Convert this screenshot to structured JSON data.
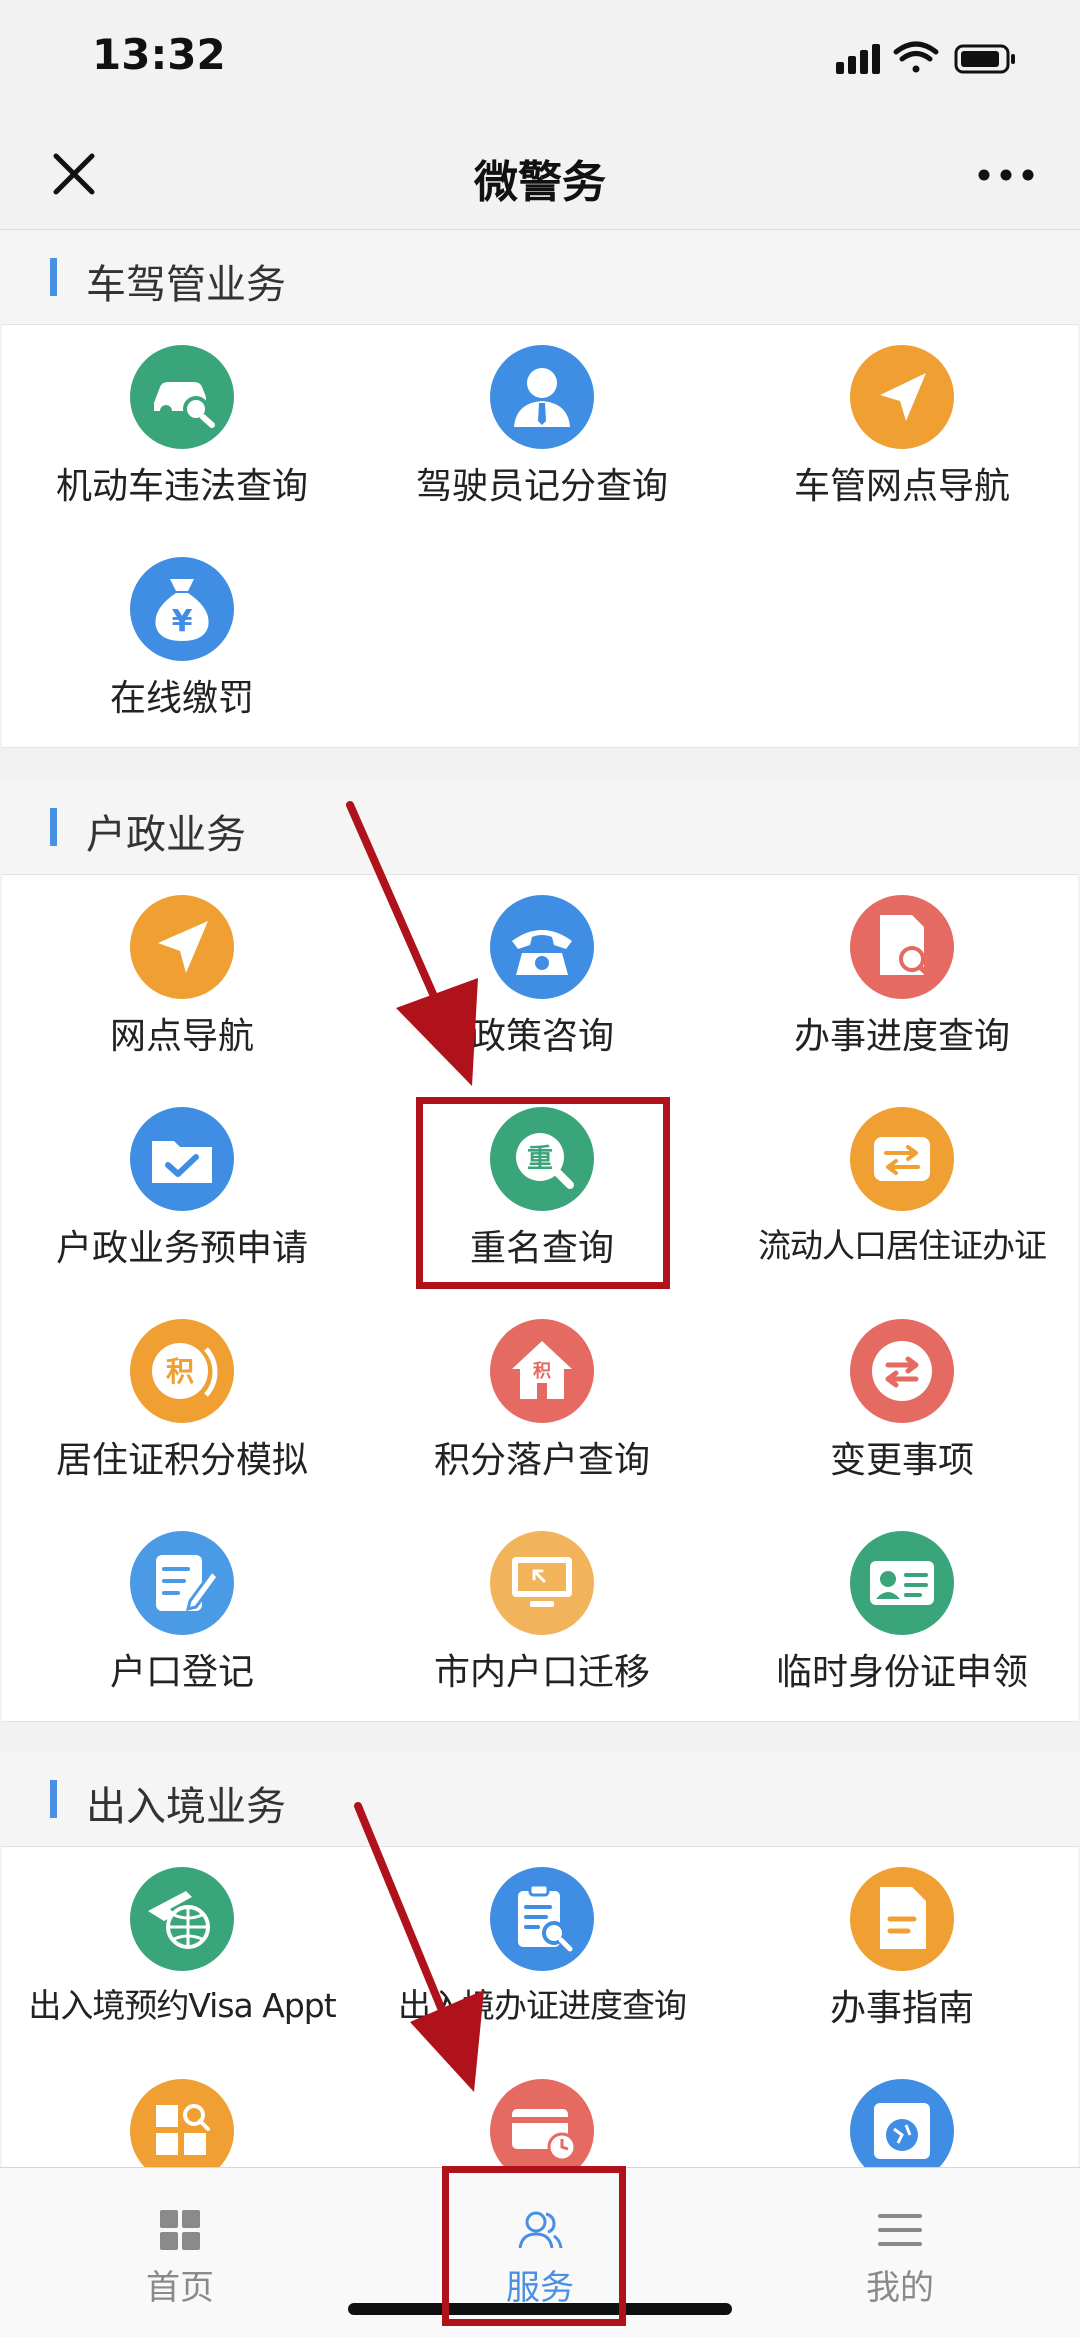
{
  "status_bar": {
    "time": "13:32"
  },
  "nav": {
    "title": "微警务",
    "close_icon": "close-icon",
    "more_icon": "more-icon"
  },
  "colors": {
    "accent": "#4a90e2",
    "green": "#3aa57a",
    "blue": "#3f8ee4",
    "orange": "#f0a033",
    "red": "#e46a62",
    "annotation": "#b0121b"
  },
  "sections": [
    {
      "title": "车驾管业务",
      "items": [
        {
          "label": "机动车违法查询",
          "icon": "car-search-icon",
          "color": "#3aa57a"
        },
        {
          "label": "驾驶员记分查询",
          "icon": "driver-icon",
          "color": "#3f8ee4"
        },
        {
          "label": "车管网点导航",
          "icon": "navigation-icon",
          "color": "#f0a033"
        },
        {
          "label": "在线缴罚",
          "icon": "money-bag-icon",
          "color": "#3f8ee4"
        }
      ]
    },
    {
      "title": "户政业务",
      "items": [
        {
          "label": "网点导航",
          "icon": "navigation-icon",
          "color": "#f0a033"
        },
        {
          "label": "政策咨询",
          "icon": "telephone-icon",
          "color": "#3f8ee4"
        },
        {
          "label": "办事进度查询",
          "icon": "document-search-icon",
          "color": "#e46a62"
        },
        {
          "label": "户政业务预申请",
          "icon": "folder-check-icon",
          "color": "#3f8ee4"
        },
        {
          "label": "重名查询",
          "icon": "duplicate-name-search-icon",
          "color": "#3aa57a",
          "glyph": "重"
        },
        {
          "label": "流动人口居住证办证",
          "icon": "exchange-icon",
          "color": "#f0a033"
        },
        {
          "label": "居住证积分模拟",
          "icon": "points-icon",
          "color": "#f0a033",
          "glyph": "积"
        },
        {
          "label": "积分落户查询",
          "icon": "house-points-icon",
          "color": "#e46a62",
          "glyph": "积"
        },
        {
          "label": "变更事项",
          "icon": "swap-icon",
          "color": "#e46a62"
        },
        {
          "label": "户口登记",
          "icon": "edit-form-icon",
          "color": "#4a9ae6"
        },
        {
          "label": "市内户口迁移",
          "icon": "monitor-icon",
          "color": "#f2b45a"
        },
        {
          "label": "临时身份证申领",
          "icon": "id-card-icon",
          "color": "#3aa57a"
        }
      ]
    },
    {
      "title": "出入境业务",
      "items": [
        {
          "label": "出入境预约Visa Appt",
          "icon": "plane-globe-icon",
          "color": "#3aa57a"
        },
        {
          "label": "出入境办证进度查询",
          "icon": "clipboard-search-icon",
          "color": "#3f8ee4"
        },
        {
          "label": "办事指南",
          "icon": "guide-document-icon",
          "color": "#f0a033"
        },
        {
          "label": "",
          "icon": "grid-search-icon",
          "color": "#f0a033"
        },
        {
          "label": "",
          "icon": "card-clock-icon",
          "color": "#e46a62"
        },
        {
          "label": "",
          "icon": "globe-window-icon",
          "color": "#3f8ee4"
        }
      ]
    }
  ],
  "tabs": [
    {
      "label": "首页",
      "icon": "grid-home-icon",
      "active": false
    },
    {
      "label": "服务",
      "icon": "users-icon",
      "active": true
    },
    {
      "label": "我的",
      "icon": "menu-lines-icon",
      "active": false
    }
  ]
}
